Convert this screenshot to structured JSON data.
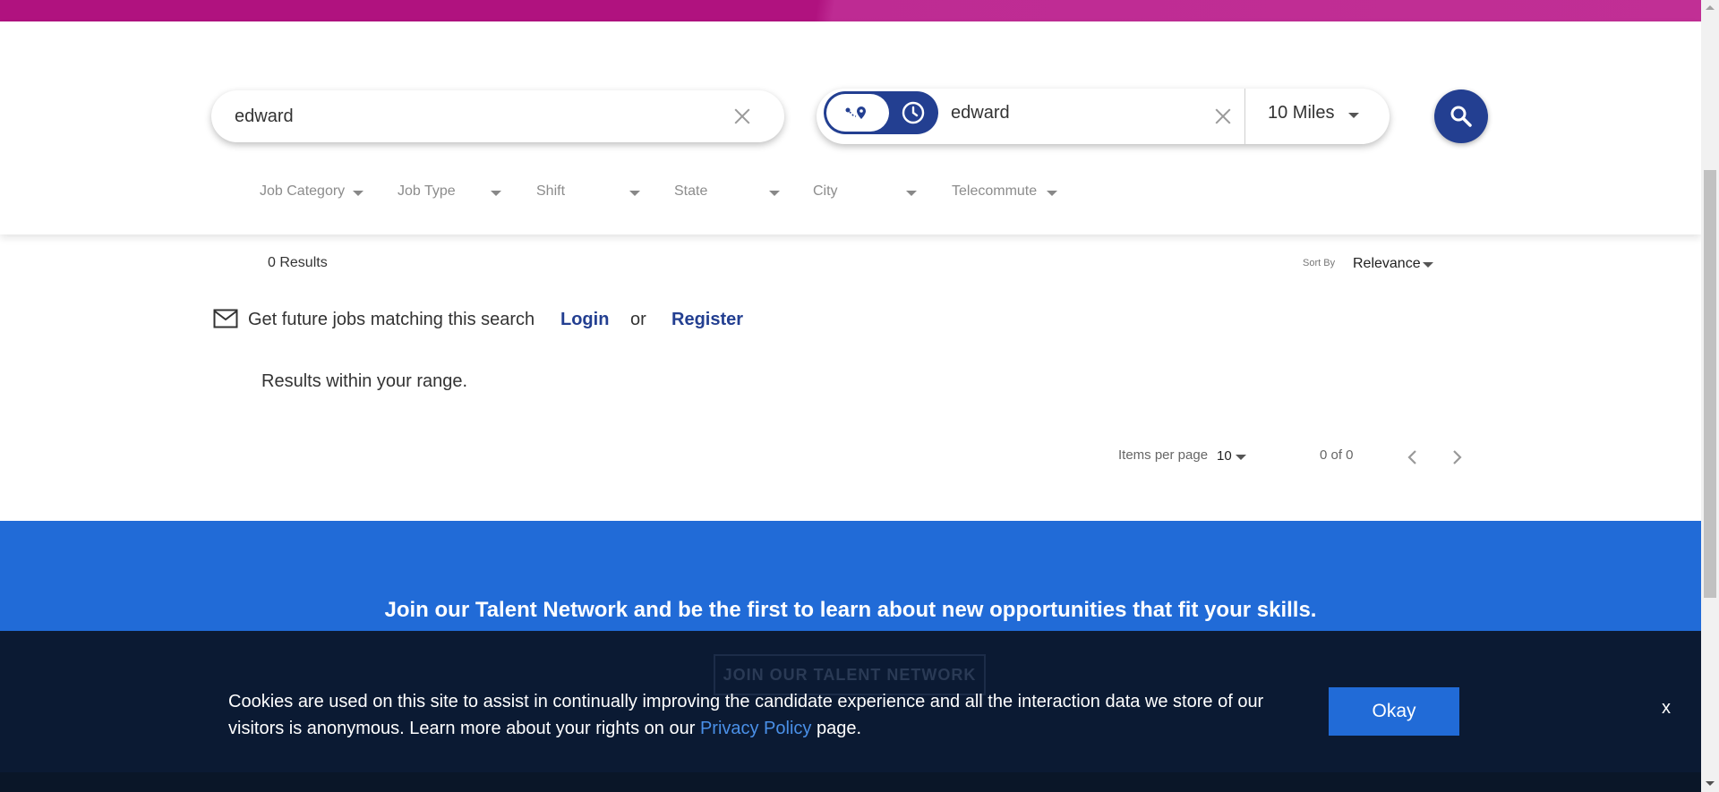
{
  "search": {
    "keyword_value": "edward",
    "location_value": "edward",
    "distance": "10 Miles"
  },
  "filters": [
    "Job Category",
    "Job Type",
    "Shift",
    "State",
    "City",
    "Telecommute"
  ],
  "results": {
    "count": "0 Results",
    "sort_label": "Sort By",
    "sort_value": "Relevance",
    "alert_text": "Get future jobs matching this search",
    "login_label": "Login",
    "or_text": "or",
    "register_label": "Register",
    "range_message": "Results within your range.",
    "items_per_page_label": "Items per page",
    "items_per_page_value": "10",
    "page_range": "0 of 0"
  },
  "talent_network": {
    "headline": "Join our Talent Network and be the first to learn about new opportunities that fit your skills.",
    "button_label": "JOIN OUR TALENT NETWORK"
  },
  "cookie": {
    "text_before": "Cookies are used on this site to assist in continually improving the candidate experience and all the interaction data we store of our visitors is anonymous. Learn more about your rights on our ",
    "link_text": "Privacy Policy",
    "text_after": " page.",
    "okay_label": "Okay",
    "close_label": "x"
  },
  "colors": {
    "brand_magenta": "#b0127f",
    "brand_navy": "#233f91",
    "talent_blue": "#216bd7",
    "cookie_bg": "#0b1a33"
  },
  "icons": [
    "route-pin-icon",
    "clock-icon",
    "search-icon",
    "mail-icon",
    "chevron-left-icon",
    "chevron-right-icon",
    "close-icon",
    "caret-down-icon"
  ]
}
